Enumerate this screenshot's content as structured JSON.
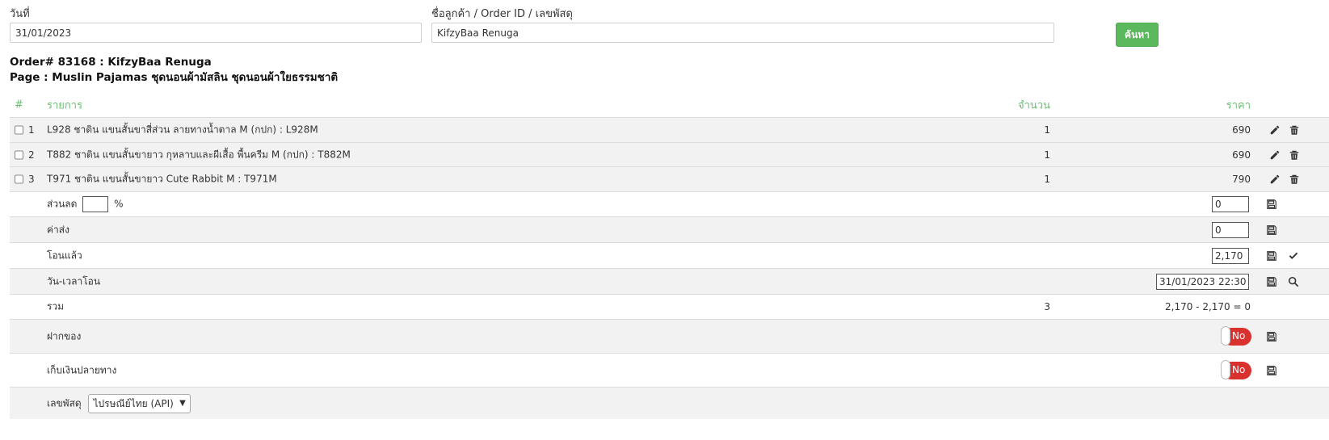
{
  "search": {
    "date_label": "วันที่",
    "date_value": "31/01/2023",
    "query_label": "ชื่อลูกค้า / Order ID / เลขพัสดุ",
    "query_value": "KifzyBaa Renuga",
    "button_label": "ค้นหา"
  },
  "order": {
    "title": "Order# 83168 : KifzyBaa Renuga",
    "page": "Page : Muslin Pajamas ชุดนอนผ้ามัสลิน ชุดนอนผ้าใยธรรมชาติ"
  },
  "table": {
    "headers": {
      "num": "#",
      "item": "รายการ",
      "qty": "จำนวน",
      "price": "ราคา"
    },
    "items": [
      {
        "num": "1",
        "name": "L928 ชาติน แขนสั้นขาสี่ส่วน ลายทางน้ำตาล M (กปก) : L928M",
        "qty": "1",
        "price": "690"
      },
      {
        "num": "2",
        "name": "T882 ชาติน แขนสั้นขายาว กุหลาบและผีเสื้อ พื้นครีม M (กปก) : T882M",
        "qty": "1",
        "price": "690"
      },
      {
        "num": "3",
        "name": "T971 ชาติน แขนสั้นขายาว Cute Rabbit M : T971M",
        "qty": "1",
        "price": "790"
      }
    ],
    "discount": {
      "label": "ส่วนลด",
      "percent_value": "",
      "percent_sign": "%",
      "value": "0"
    },
    "shipping": {
      "label": "ค่าส่ง",
      "value": "0"
    },
    "paid": {
      "label": "โอนแล้ว",
      "value": "2,170"
    },
    "transfer_time": {
      "label": "วัน-เวลาโอน",
      "value": "31/01/2023 22:30"
    },
    "total": {
      "label": "รวม",
      "qty": "3",
      "summary": "2,170 - 2,170 = 0"
    },
    "deposit": {
      "label": "ฝากของ",
      "toggle": "No"
    },
    "cod": {
      "label": "เก็บเงินปลายทาง",
      "toggle": "No"
    },
    "tracking": {
      "label": "เลขพัสดุ",
      "carrier_selected": "ไปรษณีย์ไทย (API)"
    }
  },
  "colors": {
    "accent_green": "#5cb85c",
    "header_green": "#6bbf73",
    "toggle_red": "#d9312e"
  },
  "icons": [
    "pencil-icon",
    "trash-icon",
    "save-icon",
    "check-icon",
    "search-icon",
    "chevron-down-icon"
  ]
}
